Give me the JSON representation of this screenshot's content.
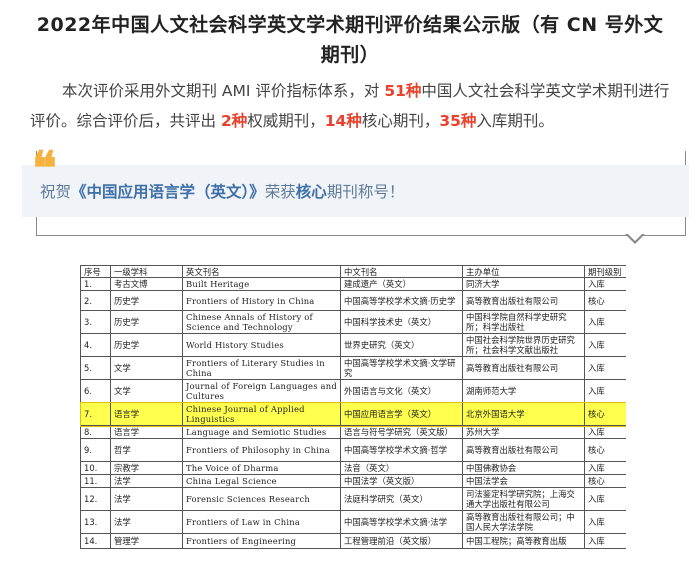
{
  "article": {
    "title": "2022年中国人文社会科学英文学术期刊评价结果公示版（有 CN 号外文期刊）",
    "intro_before_51": "本次评价采用外文期刊 AMI 评价指标体系，对 ",
    "count_total": "51种",
    "intro_after_51": "中国人文社会科学英文学术期刊进行评价。综合评价后，共评出 ",
    "count_authority": "2种",
    "intro_authority": "权威期刊，",
    "count_core": "14种",
    "intro_core": "核心期刊，",
    "count_entry": "35种",
    "intro_entry": "入库期刊。"
  },
  "quote": {
    "mark": "❝",
    "text_before": "祝贺",
    "journal": "《中国应用语言学（英文）》",
    "text_mid": "荣获",
    "level": "核心",
    "text_after": "期刊称号！"
  },
  "table": {
    "headers": [
      "序号",
      "一级学科",
      "英文刊名",
      "中文刊名",
      "主办单位",
      "期刊级别"
    ],
    "rows": [
      [
        "1.",
        "考古文博",
        "Built Heritage",
        "建成遗产（英文）",
        "同济大学",
        "入库"
      ],
      [
        "2.",
        "历史学",
        "Frontiers of History in China",
        "中国高等学校学术文摘·历史学",
        "高等教育出版社有限公司",
        "核心"
      ],
      [
        "3.",
        "历史学",
        "Chinese Annals of History of Science and Technology",
        "中国科学技术史（英文）",
        "中国科学院自然科学史研究所；科学出版社",
        "入库"
      ],
      [
        "4.",
        "历史学",
        "World History Studies",
        "世界史研究（英文）",
        "中国社会科学院世界历史研究所；社会科学文献出版社",
        "入库"
      ],
      [
        "5.",
        "文学",
        "Frontiers of Literary Studies in China",
        "中国高等学校学术文摘·文学研究",
        "高等教育出版社有限公司",
        "入库"
      ],
      [
        "6.",
        "文学",
        "Journal of Foreign Languages and Cultures",
        "外国语言与文化（英文）",
        "湖南师范大学",
        "入库"
      ],
      [
        "7.",
        "语言学",
        "Chinese Journal of Applied Linguistics",
        "中国应用语言学（英文）",
        "北京外国语大学",
        "核心"
      ],
      [
        "8.",
        "语言学",
        "Language and Semiotic Studies",
        "语言与符号学研究（英文版）",
        "苏州大学",
        "入库"
      ],
      [
        "9.",
        "哲学",
        "Frontiers of Philosophy in China",
        "中国高等学校学术文摘·哲学",
        "高等教育出版社有限公司",
        "核心"
      ],
      [
        "10.",
        "宗教学",
        "The Voice of Dharma",
        "法音（英文）",
        "中国佛教协会",
        "入库"
      ],
      [
        "11.",
        "法学",
        "China Legal Science",
        "中国法学（英文版）",
        "中国法学会",
        "核心"
      ],
      [
        "12.",
        "法学",
        "Forensic Sciences Research",
        "法庭科学研究（英文）",
        "司法鉴定科学研究院；上海交通大学出版社有限公司",
        "入库"
      ],
      [
        "13.",
        "法学",
        "Frontiers of Law in China",
        "中国高等学校学术文摘·法学",
        "高等教育出版社有限公司；中国人民大学法学院",
        "入库"
      ],
      [
        "14.",
        "管理学",
        "Frontiers of Engineering",
        "工程管理前沿（英文版）",
        "中国工程院；高等教育出版",
        "入库"
      ]
    ]
  },
  "colors": {
    "highlight_number": "#e8412c",
    "quote_accent": "#f5b23f",
    "quote_text": "#5d7a99",
    "table_highlight_row": "#ffff4d"
  }
}
